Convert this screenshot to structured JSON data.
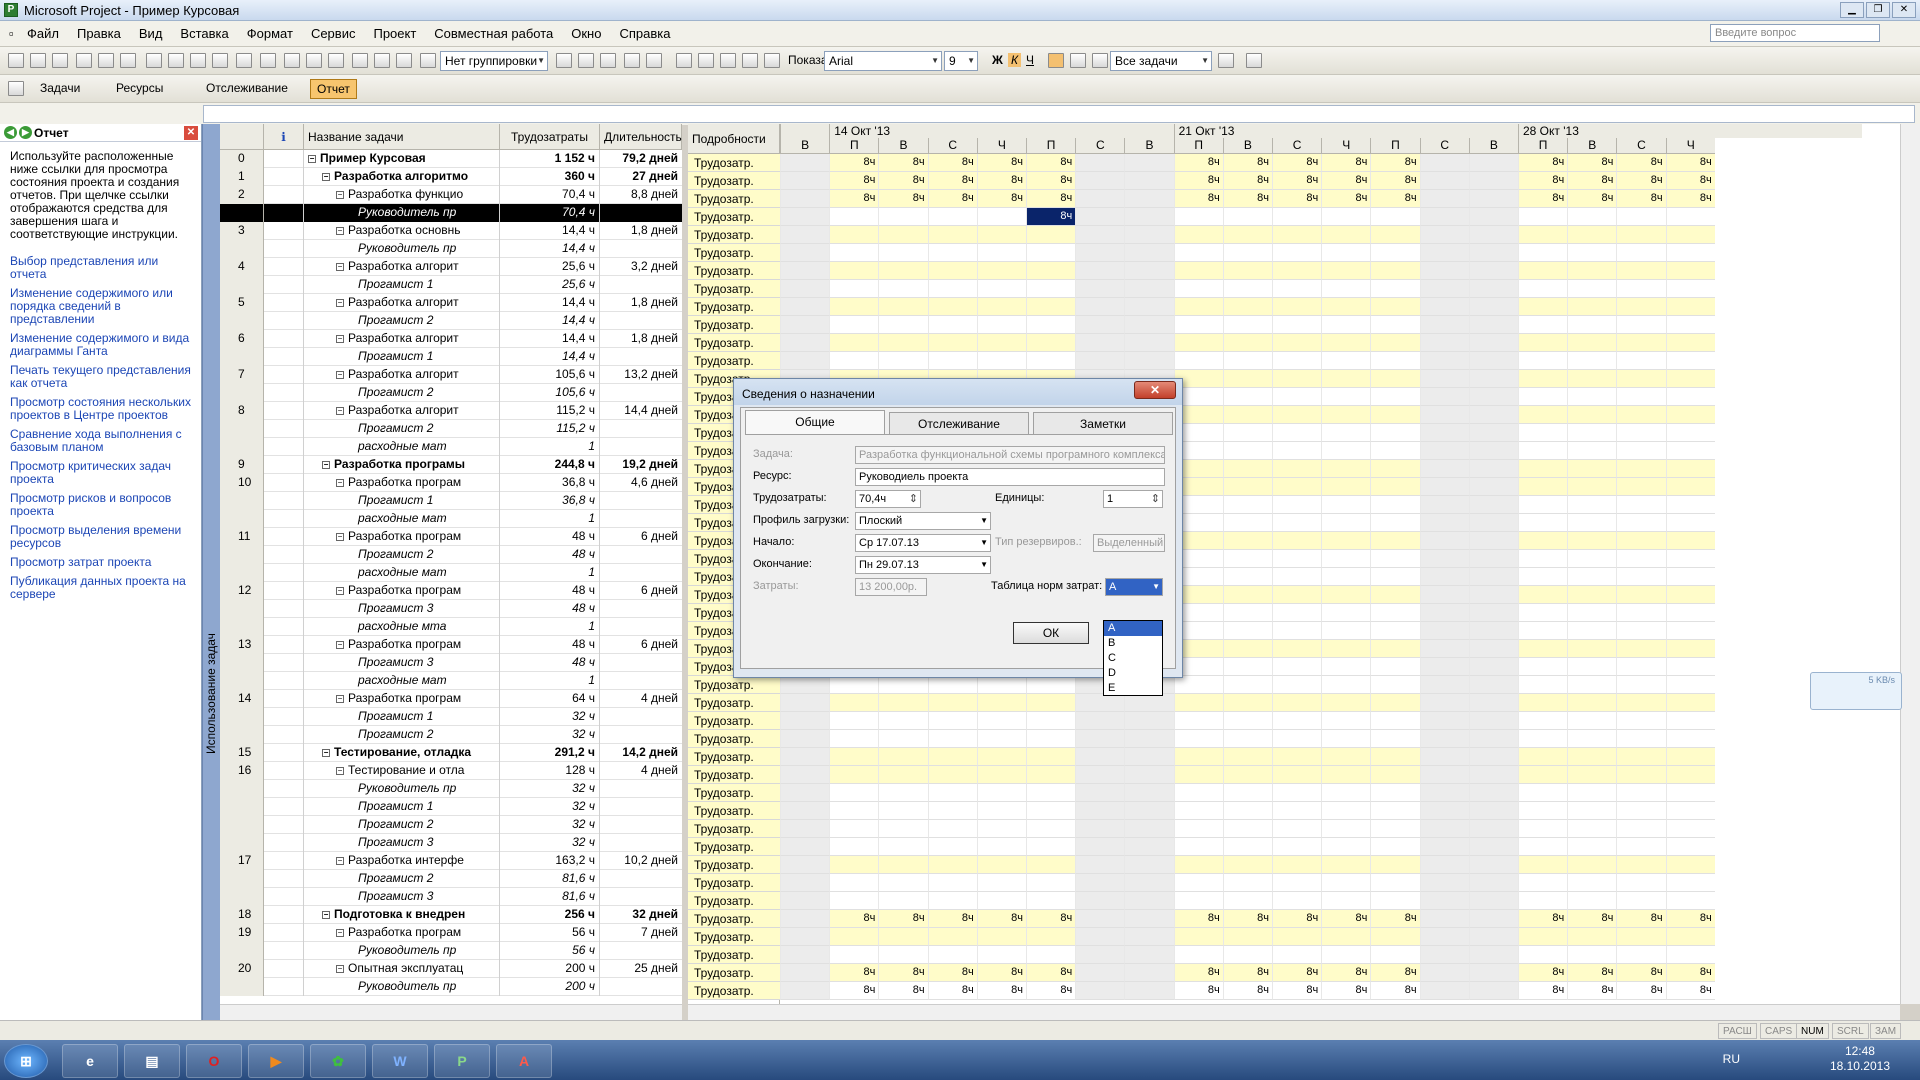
{
  "window": {
    "title": "Microsoft Project - Пример Курсовая"
  },
  "menu": [
    "Файл",
    "Правка",
    "Вид",
    "Вставка",
    "Формат",
    "Сервис",
    "Проект",
    "Совместная работа",
    "Окно",
    "Справка"
  ],
  "ask_placeholder": "Введите вопрос",
  "toolbar1": {
    "grouping": "Нет группировки",
    "show": "Показать",
    "font": "Arial",
    "size": "9",
    "filter": "Все задачи",
    "bold": "Ж",
    "italic": "К",
    "underline": "Ч"
  },
  "toolbar2": {
    "tasks": "Задачи",
    "resources": "Ресурсы",
    "tracking": "Отслеживание",
    "report": "Отчет"
  },
  "pane": {
    "title": "Отчет",
    "intro": "Используйте расположенные ниже ссылки для просмотра состояния проекта и создания отчетов. При щелчке ссылки отображаются средства для завершения шага и соответствующие инструкции.",
    "links": [
      "Выбор представления или отчета",
      "Изменение содержимого или порядка сведений в представлении",
      "Изменение содержимого и вида диаграммы Ганта",
      "Печать текущего представления как отчета",
      "Просмотр состояния нескольких проектов в Центре проектов",
      "Сравнение хода выполнения с базовым планом",
      "Просмотр критических задач проекта",
      "Просмотр рисков и вопросов проекта",
      "Просмотр выделения времени ресурсов",
      "Просмотр затрат проекта",
      "Публикация данных проекта на сервере"
    ]
  },
  "view_label": "Использование задач",
  "grid": {
    "headers": {
      "name": "Название задачи",
      "work": "Трудозатраты",
      "dur": "Длительность",
      "details": "Подробности",
      "info_icon": "info-icon"
    },
    "rows": [
      {
        "id": "0",
        "name": "Пример Курсовая",
        "work": "1 152 ч",
        "dur": "79,2 дней",
        "lvl": 0,
        "t": "s"
      },
      {
        "id": "1",
        "name": "Разработка алгоритмо",
        "work": "360 ч",
        "dur": "27 дней",
        "lvl": 1,
        "t": "s"
      },
      {
        "id": "2",
        "name": "Разработка функцио",
        "work": "70,4 ч",
        "dur": "8,8 дней",
        "lvl": 2,
        "t": "t"
      },
      {
        "id": "",
        "name": "Руководитель пр",
        "work": "70,4 ч",
        "dur": "",
        "lvl": 3,
        "t": "a",
        "sel": true
      },
      {
        "id": "3",
        "name": "Разработка основнь",
        "work": "14,4 ч",
        "dur": "1,8 дней",
        "lvl": 2,
        "t": "t"
      },
      {
        "id": "",
        "name": "Руководитель пр",
        "work": "14,4 ч",
        "dur": "",
        "lvl": 3,
        "t": "a"
      },
      {
        "id": "4",
        "name": "Разработка алгорит",
        "work": "25,6 ч",
        "dur": "3,2 дней",
        "lvl": 2,
        "t": "t"
      },
      {
        "id": "",
        "name": "Прогамист 1",
        "work": "25,6 ч",
        "dur": "",
        "lvl": 3,
        "t": "a"
      },
      {
        "id": "5",
        "name": "Разработка алгорит",
        "work": "14,4 ч",
        "dur": "1,8 дней",
        "lvl": 2,
        "t": "t"
      },
      {
        "id": "",
        "name": "Прогамист 2",
        "work": "14,4 ч",
        "dur": "",
        "lvl": 3,
        "t": "a"
      },
      {
        "id": "6",
        "name": "Разработка алгорит",
        "work": "14,4 ч",
        "dur": "1,8 дней",
        "lvl": 2,
        "t": "t"
      },
      {
        "id": "",
        "name": "Прогамист 1",
        "work": "14,4 ч",
        "dur": "",
        "lvl": 3,
        "t": "a"
      },
      {
        "id": "7",
        "name": "Разработка алгорит",
        "work": "105,6 ч",
        "dur": "13,2 дней",
        "lvl": 2,
        "t": "t"
      },
      {
        "id": "",
        "name": "Прогамист 2",
        "work": "105,6 ч",
        "dur": "",
        "lvl": 3,
        "t": "a"
      },
      {
        "id": "8",
        "name": "Разработка алгорит",
        "work": "115,2 ч",
        "dur": "14,4 дней",
        "lvl": 2,
        "t": "t"
      },
      {
        "id": "",
        "name": "Прогамист 2",
        "work": "115,2 ч",
        "dur": "",
        "lvl": 3,
        "t": "a"
      },
      {
        "id": "",
        "name": "расходные мат",
        "work": "1",
        "dur": "",
        "lvl": 3,
        "t": "a"
      },
      {
        "id": "9",
        "name": "Разработка програмы",
        "work": "244,8 ч",
        "dur": "19,2 дней",
        "lvl": 1,
        "t": "s"
      },
      {
        "id": "10",
        "name": "Разработка програм",
        "work": "36,8 ч",
        "dur": "4,6 дней",
        "lvl": 2,
        "t": "t"
      },
      {
        "id": "",
        "name": "Прогамист 1",
        "work": "36,8 ч",
        "dur": "",
        "lvl": 3,
        "t": "a"
      },
      {
        "id": "",
        "name": "расходные мат",
        "work": "1",
        "dur": "",
        "lvl": 3,
        "t": "a"
      },
      {
        "id": "11",
        "name": "Разработка програм",
        "work": "48 ч",
        "dur": "6 дней",
        "lvl": 2,
        "t": "t"
      },
      {
        "id": "",
        "name": "Прогамист 2",
        "work": "48 ч",
        "dur": "",
        "lvl": 3,
        "t": "a"
      },
      {
        "id": "",
        "name": "расходные мат",
        "work": "1",
        "dur": "",
        "lvl": 3,
        "t": "a"
      },
      {
        "id": "12",
        "name": "Разработка програм",
        "work": "48 ч",
        "dur": "6 дней",
        "lvl": 2,
        "t": "t"
      },
      {
        "id": "",
        "name": "Прогамист 3",
        "work": "48 ч",
        "dur": "",
        "lvl": 3,
        "t": "a"
      },
      {
        "id": "",
        "name": "расходные мта",
        "work": "1",
        "dur": "",
        "lvl": 3,
        "t": "a"
      },
      {
        "id": "13",
        "name": "Разработка програм",
        "work": "48 ч",
        "dur": "6 дней",
        "lvl": 2,
        "t": "t"
      },
      {
        "id": "",
        "name": "Прогамист 3",
        "work": "48 ч",
        "dur": "",
        "lvl": 3,
        "t": "a"
      },
      {
        "id": "",
        "name": "расходные мат",
        "work": "1",
        "dur": "",
        "lvl": 3,
        "t": "a"
      },
      {
        "id": "14",
        "name": "Разработка програм",
        "work": "64 ч",
        "dur": "4 дней",
        "lvl": 2,
        "t": "t"
      },
      {
        "id": "",
        "name": "Прогамист 1",
        "work": "32 ч",
        "dur": "",
        "lvl": 3,
        "t": "a"
      },
      {
        "id": "",
        "name": "Прогамист 2",
        "work": "32 ч",
        "dur": "",
        "lvl": 3,
        "t": "a"
      },
      {
        "id": "15",
        "name": "Тестирование, отладка",
        "work": "291,2 ч",
        "dur": "14,2 дней",
        "lvl": 1,
        "t": "s"
      },
      {
        "id": "16",
        "name": "Тестирование и отла",
        "work": "128 ч",
        "dur": "4 дней",
        "lvl": 2,
        "t": "t"
      },
      {
        "id": "",
        "name": "Руководитель пр",
        "work": "32 ч",
        "dur": "",
        "lvl": 3,
        "t": "a"
      },
      {
        "id": "",
        "name": "Прогамист 1",
        "work": "32 ч",
        "dur": "",
        "lvl": 3,
        "t": "a"
      },
      {
        "id": "",
        "name": "Прогамист 2",
        "work": "32 ч",
        "dur": "",
        "lvl": 3,
        "t": "a"
      },
      {
        "id": "",
        "name": "Прогамист 3",
        "work": "32 ч",
        "dur": "",
        "lvl": 3,
        "t": "a"
      },
      {
        "id": "17",
        "name": "Разработка интерфе",
        "work": "163,2 ч",
        "dur": "10,2 дней",
        "lvl": 2,
        "t": "t"
      },
      {
        "id": "",
        "name": "Прогамист 2",
        "work": "81,6 ч",
        "dur": "",
        "lvl": 3,
        "t": "a"
      },
      {
        "id": "",
        "name": "Прогамист 3",
        "work": "81,6 ч",
        "dur": "",
        "lvl": 3,
        "t": "a"
      },
      {
        "id": "18",
        "name": "Подготовка к внедрен",
        "work": "256 ч",
        "dur": "32 дней",
        "lvl": 1,
        "t": "s"
      },
      {
        "id": "19",
        "name": "Разработка програм",
        "work": "56 ч",
        "dur": "7 дней",
        "lvl": 2,
        "t": "t"
      },
      {
        "id": "",
        "name": "Руководитель пр",
        "work": "56 ч",
        "dur": "",
        "lvl": 3,
        "t": "a"
      },
      {
        "id": "20",
        "name": "Опытная эксплуатац",
        "work": "200 ч",
        "dur": "25 дней",
        "lvl": 2,
        "t": "t"
      },
      {
        "id": "",
        "name": "Руководитель пр",
        "work": "200 ч",
        "dur": "",
        "lvl": 3,
        "t": "a"
      }
    ]
  },
  "detail_label": "Трудозатр.",
  "timescale": {
    "weeks": [
      "14 Окт '13",
      "21 Окт '13",
      "28 Окт '13"
    ],
    "days": [
      "В",
      "П",
      "В",
      "С",
      "Ч",
      "П",
      "С",
      "В",
      "П",
      "В",
      "С",
      "Ч",
      "П",
      "С",
      "В",
      "П",
      "В",
      "С",
      "Ч"
    ],
    "value": "8ч"
  },
  "dialog": {
    "title": "Сведения о назначении",
    "tabs": [
      "Общие",
      "Отслеживание",
      "Заметки"
    ],
    "task_label": "Задача:",
    "task_value": "Разработка функциональной схемы програмного комплекса",
    "resource_label": "Ресурс:",
    "resource_value": "Руководиель проекта",
    "work_label": "Трудозатраты:",
    "work_value": "70,4ч",
    "units_label": "Единицы:",
    "units_value": "1",
    "contour_label": "Профиль загрузки:",
    "contour_value": "Плоский",
    "start_label": "Начало:",
    "start_value": "Ср 17.07.13",
    "booking_label": "Тип резервиров.:",
    "booking_value": "Выделенный",
    "finish_label": "Окончание:",
    "finish_value": "Пн 29.07.13",
    "cost_label": "Затраты:",
    "cost_value": "13 200,00р.",
    "rate_label": "Таблица норм затрат:",
    "rate_value": "A",
    "rate_options": [
      "A",
      "B",
      "C",
      "D",
      "E"
    ],
    "ok": "ОК"
  },
  "net_widget": "5 KB/s",
  "status": [
    "РАСШ",
    "CAPS",
    "NUM",
    "SCRL",
    "ЗАМ"
  ],
  "taskbar": {
    "lang": "RU",
    "time": "12:48",
    "date": "18.10.2013",
    "apps": [
      "ie-icon",
      "explorer-icon",
      "opera-icon",
      "media-icon",
      "icq-icon",
      "word-icon",
      "project-icon",
      "pdf-icon"
    ]
  }
}
